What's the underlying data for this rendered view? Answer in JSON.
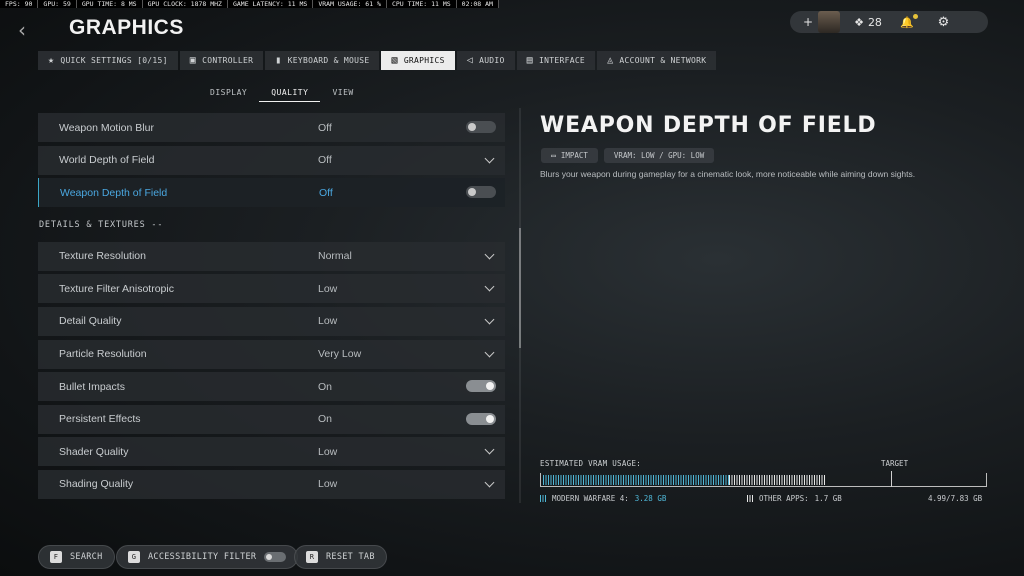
{
  "stats": [
    "FPS: 90",
    "GPU: 59",
    "GPU TIME: 8 MS",
    "GPU CLOCK: 1878 MHZ",
    "GAME LATENCY: 11 MS",
    "VRAM USAGE: 61 %",
    "CPU TIME: 11 MS",
    "02:08 AM"
  ],
  "header": {
    "title": "GRAPHICS",
    "plus": "+",
    "party_count": "28"
  },
  "tabs": [
    {
      "label": "QUICK SETTINGS [0/15]",
      "icon": "star-icon",
      "glyph": "★"
    },
    {
      "label": "CONTROLLER",
      "icon": "controller-icon",
      "glyph": "🎮"
    },
    {
      "label": "KEYBOARD & MOUSE",
      "icon": "mouse-icon",
      "glyph": "▮"
    },
    {
      "label": "GRAPHICS",
      "icon": "graphics-icon",
      "glyph": "▧"
    },
    {
      "label": "AUDIO",
      "icon": "speaker-icon",
      "glyph": "🔈"
    },
    {
      "label": "INTERFACE",
      "icon": "interface-icon",
      "glyph": "▤"
    },
    {
      "label": "ACCOUNT & NETWORK",
      "icon": "account-icon",
      "glyph": "◬"
    }
  ],
  "subtabs": [
    "DISPLAY",
    "QUALITY",
    "VIEW"
  ],
  "settings_top": [
    {
      "label": "Weapon Motion Blur",
      "value": "Off",
      "control": "toggle",
      "on": false
    },
    {
      "label": "World Depth of Field",
      "value": "Off",
      "control": "dropdown"
    },
    {
      "label": "Weapon Depth of Field",
      "value": "Off",
      "control": "toggle",
      "on": false
    }
  ],
  "section_label": "DETAILS & TEXTURES --",
  "settings_details": [
    {
      "label": "Texture Resolution",
      "value": "Normal",
      "control": "dropdown"
    },
    {
      "label": "Texture Filter Anisotropic",
      "value": "Low",
      "control": "dropdown"
    },
    {
      "label": "Detail Quality",
      "value": "Low",
      "control": "dropdown"
    },
    {
      "label": "Particle Resolution",
      "value": "Very Low",
      "control": "dropdown"
    },
    {
      "label": "Bullet Impacts",
      "value": "On",
      "control": "toggle",
      "on": true
    },
    {
      "label": "Persistent Effects",
      "value": "On",
      "control": "toggle",
      "on": true
    },
    {
      "label": "Shader Quality",
      "value": "Low",
      "control": "dropdown"
    },
    {
      "label": "Shading Quality",
      "value": "Low",
      "control": "dropdown"
    }
  ],
  "detail": {
    "title": "WEAPON DEPTH OF FIELD",
    "impact_label": "IMPACT",
    "cost_label": "VRAM: LOW / GPU: LOW",
    "description": "Blurs your weapon during gameplay for a cinematic look, more noticeable while aiming down sights."
  },
  "vram": {
    "label": "ESTIMATED VRAM USAGE:",
    "target_label": "TARGET",
    "mw_label": "MODERN WARFARE 4:",
    "mw_value": "3.28 GB",
    "mw_gb": 3.28,
    "other_label": "OTHER APPS:",
    "other_value": "1.7 GB",
    "other_gb": 1.71,
    "total_value": "4.99/7.83 GB",
    "total_gb": 7.83,
    "target_fraction": 0.79,
    "mw_color": "#4fb6d6",
    "other_color": "#e8e8e8"
  },
  "bottom": {
    "search_key": "F",
    "search_label": "SEARCH",
    "access_key": "G",
    "access_label": "ACCESSIBILITY FILTER",
    "reset_key": "R",
    "reset_label": "RESET TAB"
  }
}
